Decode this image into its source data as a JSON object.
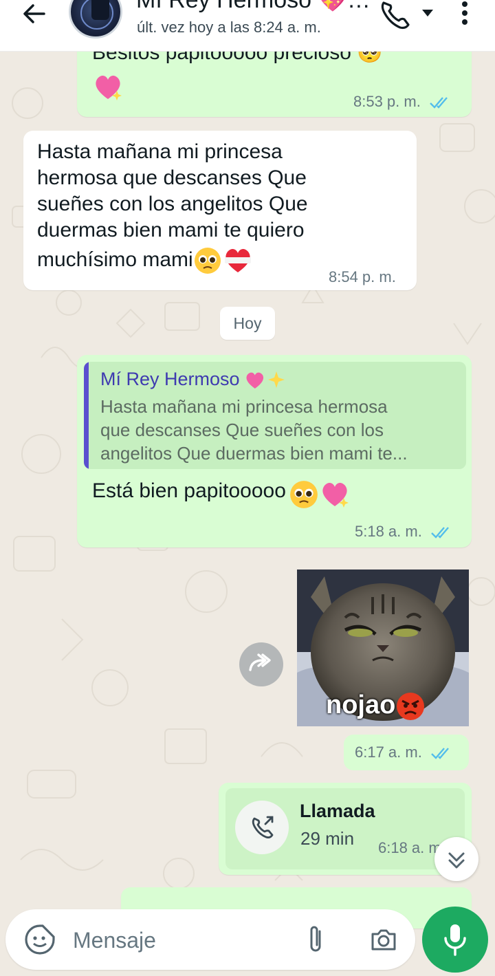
{
  "header": {
    "contact_name": "Mí Rey Hermoso 💖…",
    "last_seen": "últ. vez hoy a las 8:24 a. m."
  },
  "messages": {
    "m1": {
      "text": "Besitos papitooooo precioso 🥺",
      "time": "8:53 p. m."
    },
    "m2": {
      "lines": [
        "Hasta mañana mi princesa",
        "hermosa que descanses Que",
        "sueñes con los angelitos Que",
        "duermas bien mami te quiero",
        "muchísimo mami"
      ],
      "time": "8:54 p. m."
    },
    "day_divider": "Hoy",
    "m3": {
      "quote_name": "Mí Rey Hermoso",
      "quote_lines": [
        "Hasta mañana mi princesa hermosa",
        "que descanses Que sueñes con los",
        "angelitos Que duermas bien mami te..."
      ],
      "text": "Está bien papitooooo",
      "time": "5:18 a. m."
    },
    "m4": {
      "sticker_caption": "nojao",
      "time": "6:17 a. m."
    },
    "m5": {
      "title": "Llamada",
      "duration": "29 min",
      "time": "6:18 a. m."
    }
  },
  "composer": {
    "placeholder": "Mensaje"
  },
  "colors": {
    "outgoing": "#d9fdd3",
    "incoming": "#ffffff",
    "accent": "#1daa61",
    "ticks": "#53bdeb"
  }
}
